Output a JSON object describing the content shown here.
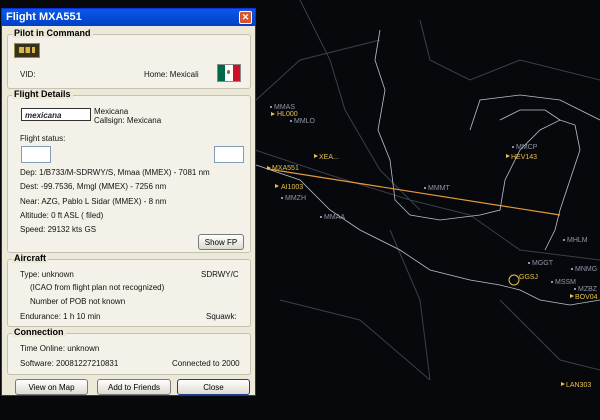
{
  "window": {
    "title": "Flight MXA551",
    "close_glyph": "✕",
    "pilot_section": {
      "heading": "Pilot in Command",
      "vid_label": "VID:",
      "home_label": "Home: Mexicali"
    },
    "flight_details": {
      "heading": "Flight Details",
      "airline_logo_text": "mexicana",
      "airline_name": "Mexicana",
      "callsign": "Callsign: Mexicana",
      "status_label": "Flight status:",
      "dep": "Dep: 1/B733/M-SDRWY/S, Mmaa (MMEX) - 7081 nm",
      "dest": "Dest: -99.7536, Mmgl (MMEX) - 7256 nm",
      "near": "Near: AZG, Pablo L Sidar (MMEX) - 8 nm",
      "altitude": "Altitude: 0 ft ASL ( filed)",
      "speed": "Speed: 29132 kts GS",
      "show_fp_button": "Show FP"
    },
    "aircraft": {
      "heading": "Aircraft",
      "type": "Type: unknown",
      "equipment": "SDRWY/C",
      "icao_note": "(ICAO from flight plan not recognized)",
      "pob": "Number of POB not known",
      "endurance": "Endurance: 1 h 10 min",
      "squawk": "Squawk:"
    },
    "connection": {
      "heading": "Connection",
      "time_online": "Time Online: unknown",
      "software": "Software: 20081227210831",
      "connected_to": "Connected to 2000"
    },
    "buttons": {
      "view_on_map": "View on Map",
      "add_friends": "Add to Friends",
      "close": "Close"
    }
  },
  "map": {
    "aircraft_labels": [
      {
        "id": "hl000",
        "text": "HL000"
      },
      {
        "id": "mxa551",
        "text": "MXA551"
      },
      {
        "id": "ai1003",
        "text": "AI1003"
      },
      {
        "id": "xea",
        "text": "XEA..."
      },
      {
        "id": "hev143",
        "text": "HEV143"
      },
      {
        "id": "ggsj",
        "text": "GGSJ"
      },
      {
        "id": "bov04",
        "text": "BOV04"
      },
      {
        "id": "lan303",
        "text": "LAN303"
      }
    ],
    "fix_labels": [
      {
        "id": "mmas",
        "text": "MMAS"
      },
      {
        "id": "mmlo",
        "text": "MMLO"
      },
      {
        "id": "mmmt",
        "text": "MMMT"
      },
      {
        "id": "mmzh",
        "text": "MMZH"
      },
      {
        "id": "mmaa",
        "text": "MMAA"
      },
      {
        "id": "mmcp",
        "text": "MMCP"
      },
      {
        "id": "mggt",
        "text": "MGGT"
      },
      {
        "id": "mhlm",
        "text": "MHLM"
      },
      {
        "id": "mssm",
        "text": "MSSM"
      },
      {
        "id": "mnmg",
        "text": "MNMG"
      },
      {
        "id": "mzbz",
        "text": "MZBZ"
      }
    ],
    "colors": {
      "aircraft": "#e6c24a",
      "route_line": "#e59a3a",
      "boundary": "#3a3f4d",
      "coast": "#b9c0cc"
    }
  }
}
